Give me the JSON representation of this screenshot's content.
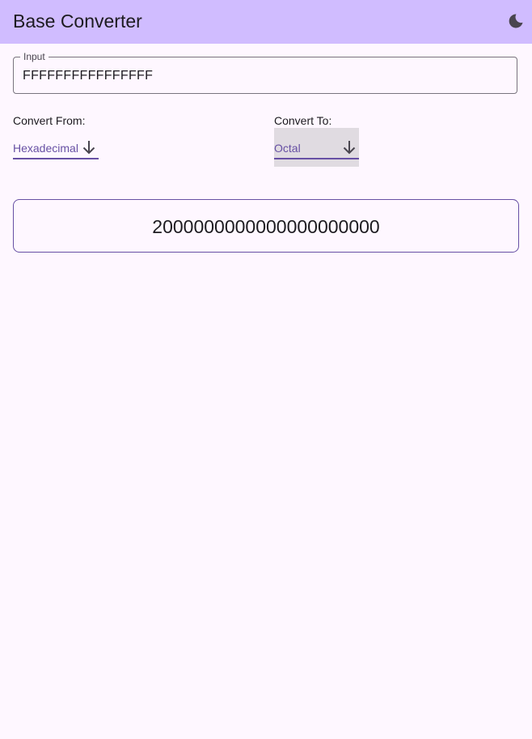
{
  "app_bar": {
    "title": "Base Converter",
    "theme_icon": "moon-icon"
  },
  "input": {
    "label": "Input",
    "value": "FFFFFFFFFFFFFFFF"
  },
  "convert_from": {
    "label": "Convert From:",
    "selected": "Hexadecimal",
    "icon": "arrow-down-icon"
  },
  "convert_to": {
    "label": "Convert To:",
    "selected": "Octal",
    "icon": "arrow-down-icon"
  },
  "result": {
    "value": "2000000000000000000000"
  },
  "colors": {
    "app_bar": "#d0bcff",
    "background": "#fef7ff",
    "accent": "#6750a4",
    "outline": "#79747e"
  }
}
